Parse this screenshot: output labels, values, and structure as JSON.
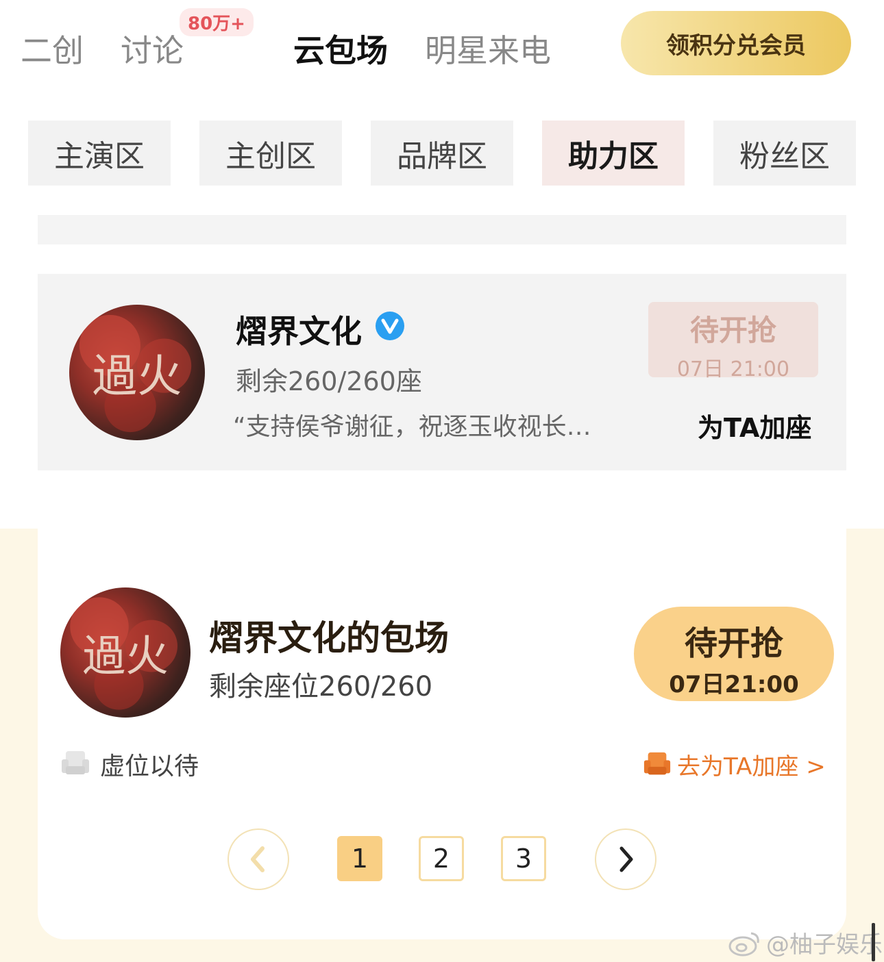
{
  "top_tabs": {
    "erchuang": "二创",
    "taolun": "讨论",
    "taolun_badge": "80万+",
    "yunbaochang": "云包场",
    "mingxing": "明星来电"
  },
  "member_button": "领积分兑会员",
  "zones": [
    "主演区",
    "主创区",
    "品牌区",
    "助力区",
    "粉丝区"
  ],
  "card1": {
    "name": "熠界文化",
    "seats": "剩余260/260座",
    "slogan": "“支持侯爷谢征，祝逐玉收视长…",
    "status_title": "待开抢",
    "status_time": "07日 21:00",
    "add_seat": "为TA加座"
  },
  "avatar_text": "過火",
  "card2": {
    "name": "熠界文化的包场",
    "seats": "剩余座位260/260",
    "status_title": "待开抢",
    "status_time": "07日21:00",
    "empty_seats": "虚位以待",
    "add_seat_link": "去为TA加座 >"
  },
  "pagination": [
    "1",
    "2",
    "3"
  ],
  "watermark": "@柚子娱乐",
  "colors": {
    "accent_gold": "#f9cf84",
    "accent_orange": "#e8772a",
    "verified_blue": "#2a9ff1",
    "badge_red": "#e4545a"
  },
  "icons": [
    "verified-icon",
    "seat-icon",
    "prev-arrow-icon",
    "next-arrow-icon",
    "weibo-icon"
  ]
}
